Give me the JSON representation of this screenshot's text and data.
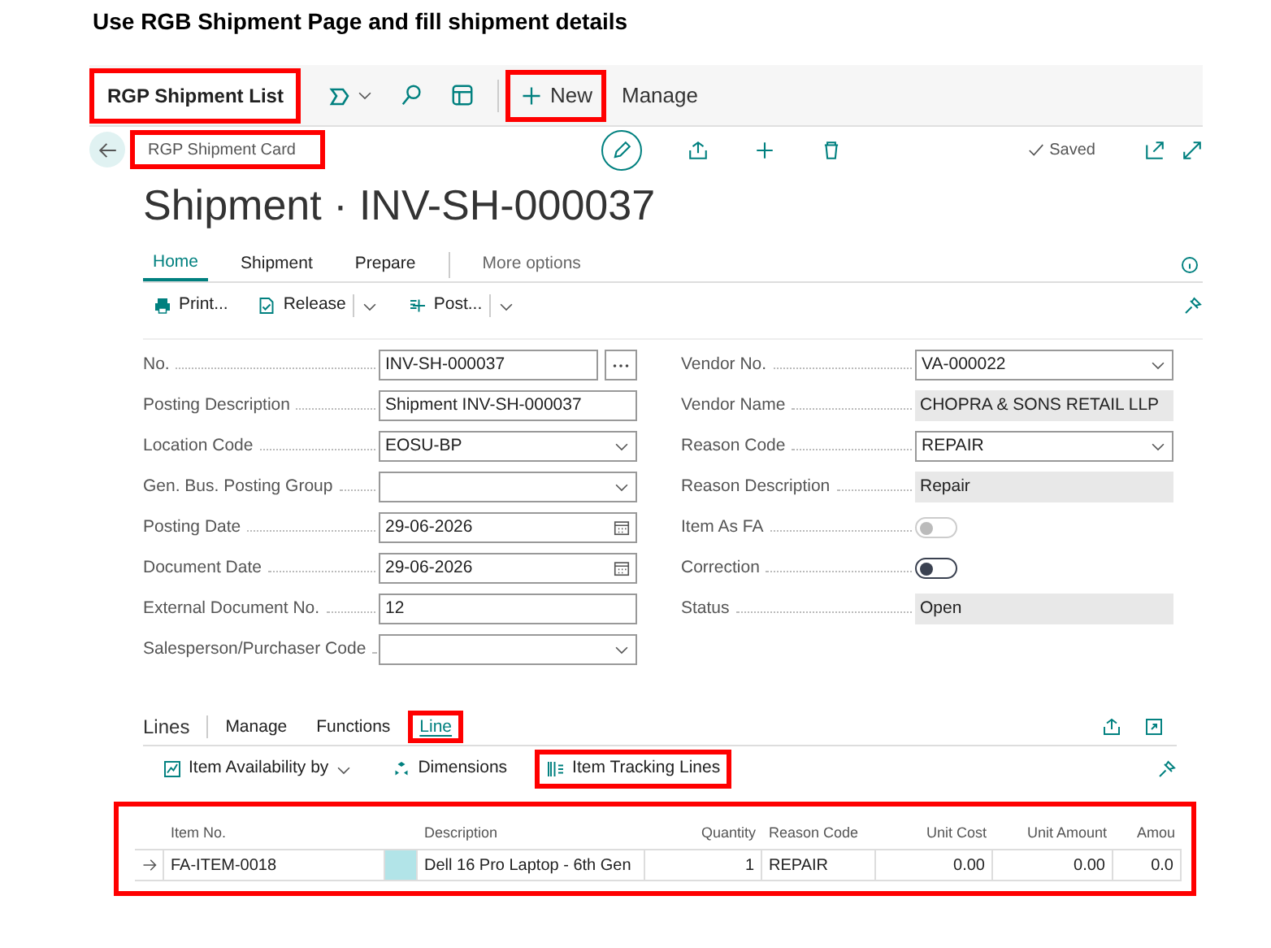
{
  "caption": "Use RGB Shipment Page and fill shipment details",
  "top_bar": {
    "title": "RGP Shipment List",
    "title_highlighted": true,
    "actions": [
      {
        "kind": "new",
        "label": "New",
        "highlighted": true
      },
      {
        "kind": "text",
        "label": "Manage",
        "highlighted": false
      }
    ]
  },
  "card": {
    "breadcrumb": "RGP Shipment Card",
    "breadcrumb_highlighted": true,
    "save_state": "Saved",
    "title": "Shipment · INV-SH-000037",
    "tabs": [
      {
        "label": "Home",
        "selected": true
      },
      {
        "label": "Shipment",
        "selected": false
      },
      {
        "label": "Prepare",
        "selected": false
      },
      {
        "label": "More options",
        "selected": false
      }
    ],
    "actions": [
      {
        "kind": "print",
        "label": "Print..."
      },
      {
        "kind": "release",
        "label": "Release"
      },
      {
        "kind": "post",
        "label": "Post..."
      }
    ]
  },
  "fields_left": [
    {
      "label": "No.",
      "kind": "assist",
      "value": "INV-SH-000037"
    },
    {
      "label": "Posting Description",
      "kind": "text",
      "value": "Shipment INV-SH-000037"
    },
    {
      "label": "Location Code",
      "kind": "select",
      "value": "EOSU-BP"
    },
    {
      "label": "Gen. Bus. Posting Group",
      "kind": "select"
    },
    {
      "label": "Posting Date",
      "kind": "date",
      "value": "29-06-2026"
    },
    {
      "label": "Document Date",
      "kind": "date",
      "value": "29-06-2026"
    },
    {
      "label": "External Document No.",
      "kind": "text",
      "value": "12"
    },
    {
      "label": "Salesperson/Purchaser Code",
      "kind": "select"
    }
  ],
  "fields_right": [
    {
      "label": "Vendor No.",
      "kind": "select",
      "value": "VA-000022"
    },
    {
      "label": "Vendor Name",
      "kind": "readonly",
      "value": "CHOPRA & SONS RETAIL LLP"
    },
    {
      "label": "Reason Code",
      "kind": "select",
      "value": "REPAIR"
    },
    {
      "label": "Reason Description",
      "kind": "readonly",
      "value": "Repair"
    },
    {
      "label": "Item As FA",
      "kind": "toggle",
      "on": false,
      "disabled": true
    },
    {
      "label": "Correction",
      "kind": "toggle",
      "on": false,
      "disabled": false
    },
    {
      "label": "Status",
      "kind": "readonly",
      "value": "Open"
    }
  ],
  "lines": {
    "title": "Lines",
    "tabs": [
      {
        "label": "Manage",
        "selected": false,
        "highlighted": false
      },
      {
        "label": "Functions",
        "selected": false,
        "highlighted": false
      },
      {
        "label": "Line",
        "selected": true,
        "highlighted": true
      }
    ],
    "actions": [
      {
        "kind": "availability",
        "label": "Item Availability by",
        "highlighted": false
      },
      {
        "kind": "dimensions",
        "label": "Dimensions",
        "highlighted": false
      },
      {
        "kind": "tracking",
        "label": "Item Tracking Lines",
        "highlighted": true
      }
    ],
    "table_highlighted": true,
    "columns": [
      {
        "label": "Item No.",
        "numeric": false
      },
      {
        "label": "Description",
        "numeric": false
      },
      {
        "label": "Quantity",
        "numeric": true
      },
      {
        "label": "Reason Code",
        "numeric": false
      },
      {
        "label": "Unit Cost",
        "numeric": true
      },
      {
        "label": "Unit Amount",
        "numeric": true
      },
      {
        "label": "Amou",
        "numeric": true
      }
    ],
    "rows": [
      {
        "current": true,
        "highlighted": true,
        "cells": [
          "FA-ITEM-0018",
          "Dell 16 Pro Laptop - 6th Gen",
          "1",
          "REPAIR",
          "0.00",
          "0.00",
          "0.0"
        ]
      }
    ]
  }
}
